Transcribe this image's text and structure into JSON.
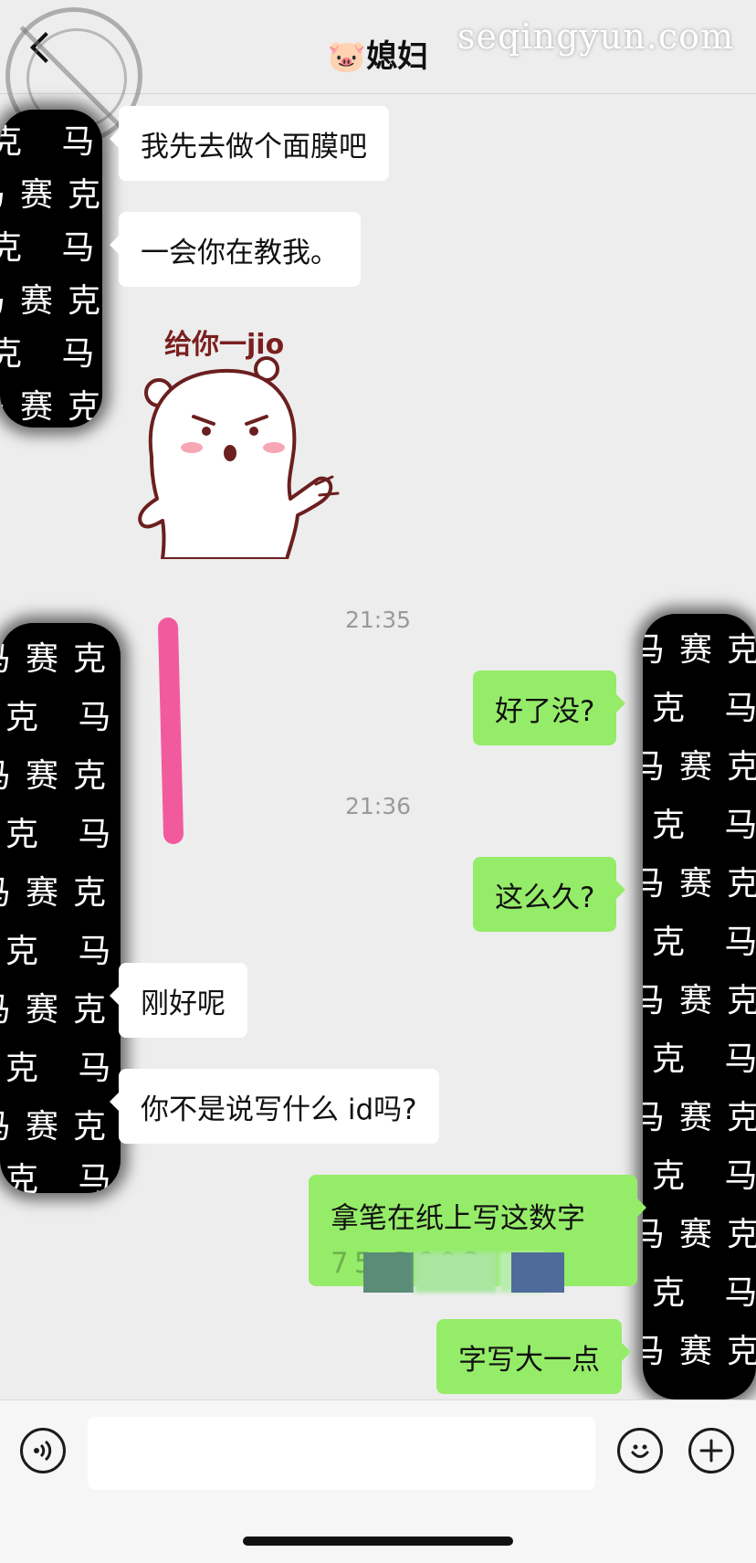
{
  "header": {
    "title": "🐷媳妇",
    "watermark_site": "seqingyun.com"
  },
  "messages": [
    {
      "side": "in",
      "text": "我先去做个面膜吧"
    },
    {
      "side": "in",
      "text": "一会你在教我。"
    },
    {
      "side": "in",
      "type": "sticker",
      "caption": "给你一jio"
    },
    {
      "type": "time",
      "text": "21:35"
    },
    {
      "side": "out",
      "text": "好了没?"
    },
    {
      "type": "time",
      "text": "21:36"
    },
    {
      "side": "out",
      "text": "这么久?"
    },
    {
      "side": "in",
      "text": "刚好呢"
    },
    {
      "side": "in",
      "text": "你不是说写什么 id吗?"
    },
    {
      "side": "out",
      "text": "拿笔在纸上写这数字",
      "line2": "75  3603"
    },
    {
      "side": "out",
      "text": "字写大一点"
    }
  ],
  "mask_text": {
    "row_a": "克 马",
    "row_b": "马赛克"
  },
  "input": {
    "value": "",
    "placeholder": ""
  },
  "colors": {
    "background": "#ededed",
    "incoming_bubble": "#ffffff",
    "outgoing_bubble": "#95ec69",
    "timestamp": "#9a9a9a",
    "mask": "#000000"
  },
  "icons": {
    "back": "chevron-left-icon",
    "voice": "voice-icon",
    "emoji": "emoji-icon",
    "plus": "plus-icon"
  }
}
